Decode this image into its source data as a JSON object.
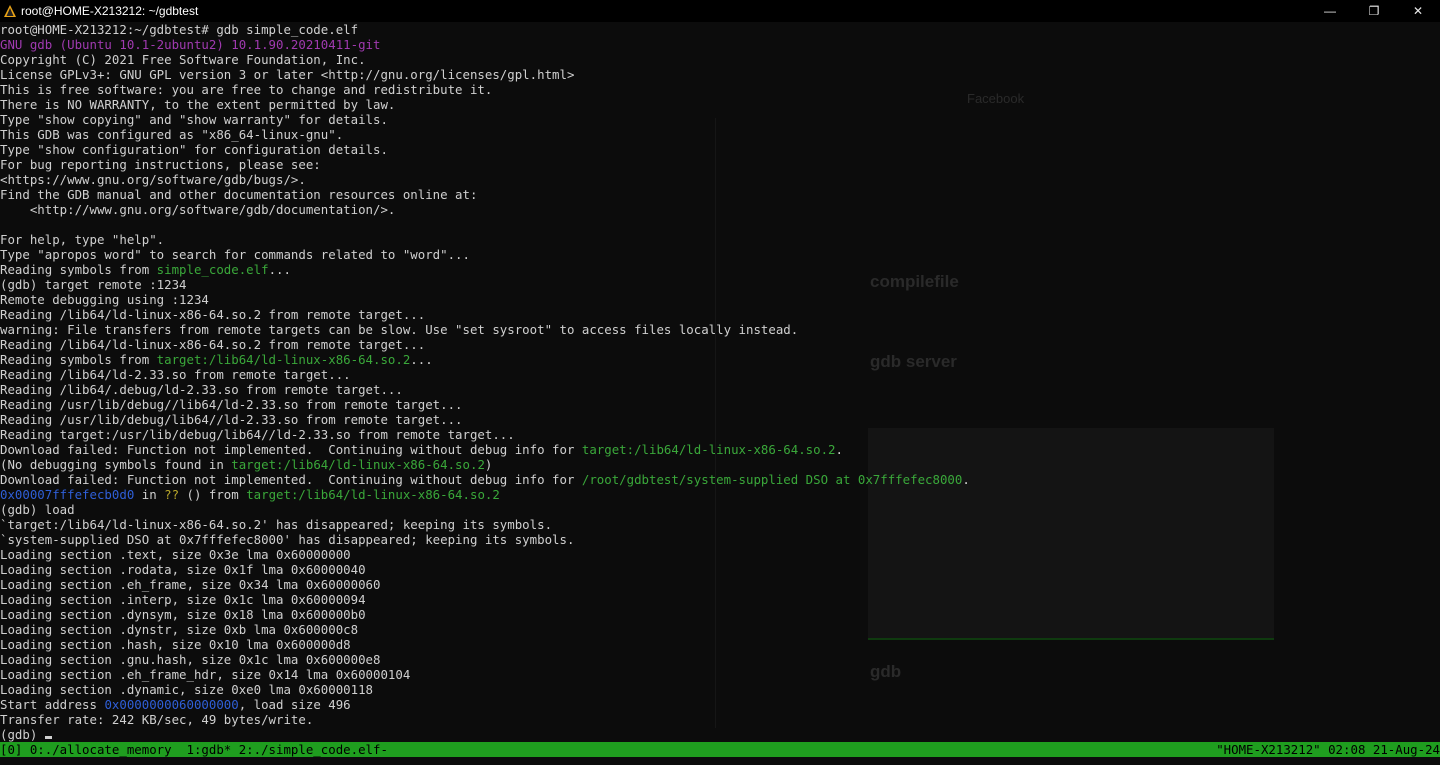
{
  "window": {
    "title": "root@HOME-X213212: ~/gdbtest",
    "minimize": "—",
    "maximize": "❐",
    "close": "✕"
  },
  "ghost": {
    "h_compile": "compilefile",
    "h_gdbserver": "gdb server",
    "h_gdb": "gdb",
    "bm_facebook": "Facebook"
  },
  "terminal": {
    "lines": [
      [
        {
          "t": "root@HOME-X213212:~/gdbtest# gdb simple_code.elf"
        }
      ],
      [
        {
          "t": "GNU gdb (Ubuntu 10.1-2ubuntu2) 10.1.90.20210411-git",
          "c": "purple"
        }
      ],
      [
        {
          "t": "Copyright (C) 2021 Free Software Foundation, Inc."
        }
      ],
      [
        {
          "t": "License GPLv3+: GNU GPL version 3 or later <http://gnu.org/licenses/gpl.html>"
        }
      ],
      [
        {
          "t": "This is free software: you are free to change and redistribute it."
        }
      ],
      [
        {
          "t": "There is NO WARRANTY, to the extent permitted by law."
        }
      ],
      [
        {
          "t": "Type \"show copying\" and \"show warranty\" for details."
        }
      ],
      [
        {
          "t": "This GDB was configured as \"x86_64-linux-gnu\"."
        }
      ],
      [
        {
          "t": "Type \"show configuration\" for configuration details."
        }
      ],
      [
        {
          "t": "For bug reporting instructions, please see:"
        }
      ],
      [
        {
          "t": "<https://www.gnu.org/software/gdb/bugs/>."
        }
      ],
      [
        {
          "t": "Find the GDB manual and other documentation resources online at:"
        }
      ],
      [
        {
          "t": "    <http://www.gnu.org/software/gdb/documentation/>."
        }
      ],
      [
        {
          "t": ""
        }
      ],
      [
        {
          "t": "For help, type \"help\"."
        }
      ],
      [
        {
          "t": "Type \"apropos word\" to search for commands related to \"word\"..."
        }
      ],
      [
        {
          "t": "Reading symbols from "
        },
        {
          "t": "simple_code.elf",
          "c": "green"
        },
        {
          "t": "..."
        }
      ],
      [
        {
          "t": "(gdb) target remote :1234"
        }
      ],
      [
        {
          "t": "Remote debugging using :1234"
        }
      ],
      [
        {
          "t": "Reading /lib64/ld-linux-x86-64.so.2 from remote target..."
        }
      ],
      [
        {
          "t": "warning: File transfers from remote targets can be slow. Use \"set sysroot\" to access files locally instead."
        }
      ],
      [
        {
          "t": "Reading /lib64/ld-linux-x86-64.so.2 from remote target..."
        }
      ],
      [
        {
          "t": "Reading symbols from "
        },
        {
          "t": "target:/lib64/ld-linux-x86-64.so.2",
          "c": "green"
        },
        {
          "t": "..."
        }
      ],
      [
        {
          "t": "Reading /lib64/ld-2.33.so from remote target..."
        }
      ],
      [
        {
          "t": "Reading /lib64/.debug/ld-2.33.so from remote target..."
        }
      ],
      [
        {
          "t": "Reading /usr/lib/debug//lib64/ld-2.33.so from remote target..."
        }
      ],
      [
        {
          "t": "Reading /usr/lib/debug/lib64//ld-2.33.so from remote target..."
        }
      ],
      [
        {
          "t": "Reading target:/usr/lib/debug/lib64//ld-2.33.so from remote target..."
        }
      ],
      [
        {
          "t": "Download failed: Function not implemented.  Continuing without debug info for "
        },
        {
          "t": "target:/lib64/ld-linux-x86-64.so.2",
          "c": "green"
        },
        {
          "t": "."
        }
      ],
      [
        {
          "t": "(No debugging symbols found in "
        },
        {
          "t": "target:/lib64/ld-linux-x86-64.so.2",
          "c": "green"
        },
        {
          "t": ")"
        }
      ],
      [
        {
          "t": "Download failed: Function not implemented.  Continuing without debug info for "
        },
        {
          "t": "/root/gdbtest/system-supplied DSO at 0x7fffefec8000",
          "c": "green"
        },
        {
          "t": "."
        }
      ],
      [
        {
          "t": "0x00007fffefecb0d0",
          "c": "blue"
        },
        {
          "t": " in "
        },
        {
          "t": "??",
          "c": "yellow"
        },
        {
          "t": " () from "
        },
        {
          "t": "target:/lib64/ld-linux-x86-64.so.2",
          "c": "green"
        }
      ],
      [
        {
          "t": "(gdb) load"
        }
      ],
      [
        {
          "t": "`target:/lib64/ld-linux-x86-64.so.2' has disappeared; keeping its symbols."
        }
      ],
      [
        {
          "t": "`system-supplied DSO at 0x7fffefec8000' has disappeared; keeping its symbols."
        }
      ],
      [
        {
          "t": "Loading section .text, size 0x3e lma 0x60000000"
        }
      ],
      [
        {
          "t": "Loading section .rodata, size 0x1f lma 0x60000040"
        }
      ],
      [
        {
          "t": "Loading section .eh_frame, size 0x34 lma 0x60000060"
        }
      ],
      [
        {
          "t": "Loading section .interp, size 0x1c lma 0x60000094"
        }
      ],
      [
        {
          "t": "Loading section .dynsym, size 0x18 lma 0x600000b0"
        }
      ],
      [
        {
          "t": "Loading section .dynstr, size 0xb lma 0x600000c8"
        }
      ],
      [
        {
          "t": "Loading section .hash, size 0x10 lma 0x600000d8"
        }
      ],
      [
        {
          "t": "Loading section .gnu.hash, size 0x1c lma 0x600000e8"
        }
      ],
      [
        {
          "t": "Loading section .eh_frame_hdr, size 0x14 lma 0x60000104"
        }
      ],
      [
        {
          "t": "Loading section .dynamic, size 0xe0 lma 0x60000118"
        }
      ],
      [
        {
          "t": "Start address "
        },
        {
          "t": "0x0000000060000000",
          "c": "blue"
        },
        {
          "t": ", load size 496"
        }
      ],
      [
        {
          "t": "Transfer rate: 242 KB/sec, 49 bytes/write."
        }
      ],
      [
        {
          "t": "(gdb) "
        }
      ]
    ]
  },
  "statusbar": {
    "left": "[0] 0:./allocate_memory  1:gdb* 2:./simple_code.elf-",
    "right": "\"HOME-X213212\" 02:08 21-Aug-24"
  }
}
